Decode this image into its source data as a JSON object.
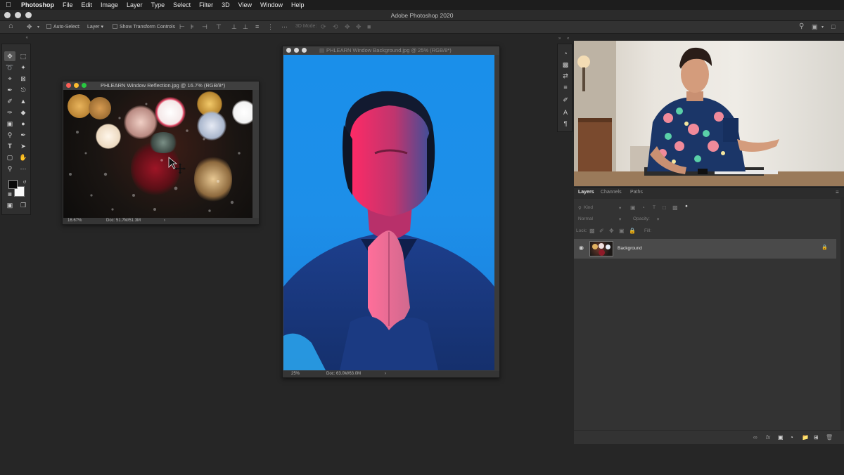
{
  "menubar": {
    "app": "Photoshop",
    "items": [
      "File",
      "Edit",
      "Image",
      "Layer",
      "Type",
      "Select",
      "Filter",
      "3D",
      "View",
      "Window",
      "Help"
    ]
  },
  "window_title": "Adobe Photoshop 2020",
  "options_bar": {
    "auto_select_label": "Auto-Select:",
    "auto_select_value": "Layer",
    "transform_label": "Show Transform Controls",
    "mode_3d": "3D Mode:"
  },
  "doc1": {
    "title": "PHLEARN Window Reflection.jpg @ 16.7% (RGB/8*)",
    "zoom": "16.67%",
    "doc_size": "Doc: 51.7M/51.3M"
  },
  "doc2": {
    "title": "PHLEARN Window Background.jpg @ 25% (RGB/8*)",
    "zoom": "25%",
    "doc_size": "Doc: 63.0M/63.0M"
  },
  "layers_panel": {
    "tabs": [
      "Layers",
      "Channels",
      "Paths"
    ],
    "kind_label": "Kind",
    "blend_mode": "Normal",
    "opacity_label": "Opacity:",
    "lock_label": "Lock:",
    "fill_label": "Fill:",
    "layers": [
      {
        "name": "Background",
        "visible": true,
        "locked": true
      }
    ]
  },
  "colors": {
    "foreground": "#0a0a0a",
    "background": "#fafafa",
    "canvas_blue": "#1a8fea",
    "neon_pink": "#ff2d6e"
  }
}
